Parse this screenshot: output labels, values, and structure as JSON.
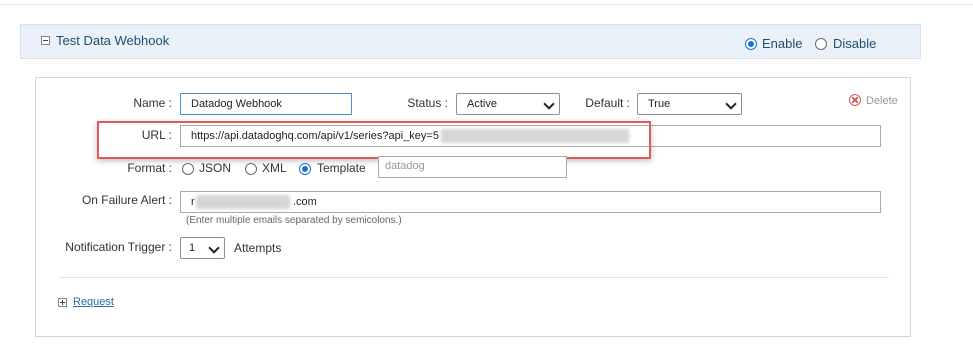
{
  "header": {
    "title": "Test Data Webhook",
    "enable_label": "Enable",
    "disable_label": "Disable",
    "selected": "Enable"
  },
  "form": {
    "name_label": "Name :",
    "name_value": "Datadog Webhook",
    "status_label": "Status :",
    "status_value": "Active",
    "default_label": "Default :",
    "default_value": "True",
    "delete_label": "Delete",
    "url_label": "URL :",
    "url_value": "https://api.datadoghq.com/api/v1/series?api_key=5",
    "format_label": "Format :",
    "format_options": [
      "JSON",
      "XML",
      "Template"
    ],
    "format_selected": "Template",
    "template_value": "datadog",
    "failure_label": "On Failure Alert :",
    "failure_value_prefix": "r",
    "failure_value_suffix": ".com",
    "failure_hint": "(Enter multiple emails separated by semicolons.)",
    "trigger_label": "Notification Trigger :",
    "trigger_value": "1",
    "trigger_unit": "Attempts"
  },
  "footer": {
    "request_label": "Request"
  }
}
